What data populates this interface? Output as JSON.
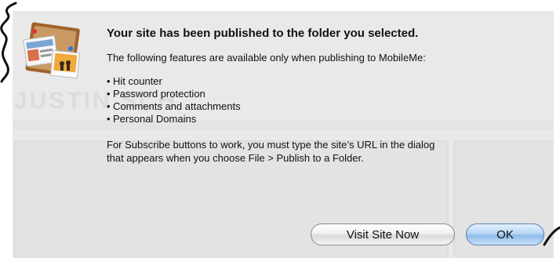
{
  "dialog": {
    "title": "Your site has been published to the folder you selected.",
    "intro": "The following features are available only when publishing to MobileMe:",
    "features": [
      "Hit counter",
      "Password protection",
      "Comments and attachments",
      "Personal Domains"
    ],
    "bullet": "•",
    "note_line1": "For Subscribe buttons to work, you must type the site’s URL in the dialog",
    "note_line2": "that appears when you choose File > Publish to a Folder."
  },
  "buttons": {
    "visit": "Visit Site Now",
    "ok": "OK"
  },
  "background": {
    "ghost_text": "JUSTIN   SCH"
  },
  "icon": "iweb-corkboard-icon",
  "colors": {
    "dialog_bg": "#e9e9e9",
    "default_button": "#8fbce9"
  }
}
